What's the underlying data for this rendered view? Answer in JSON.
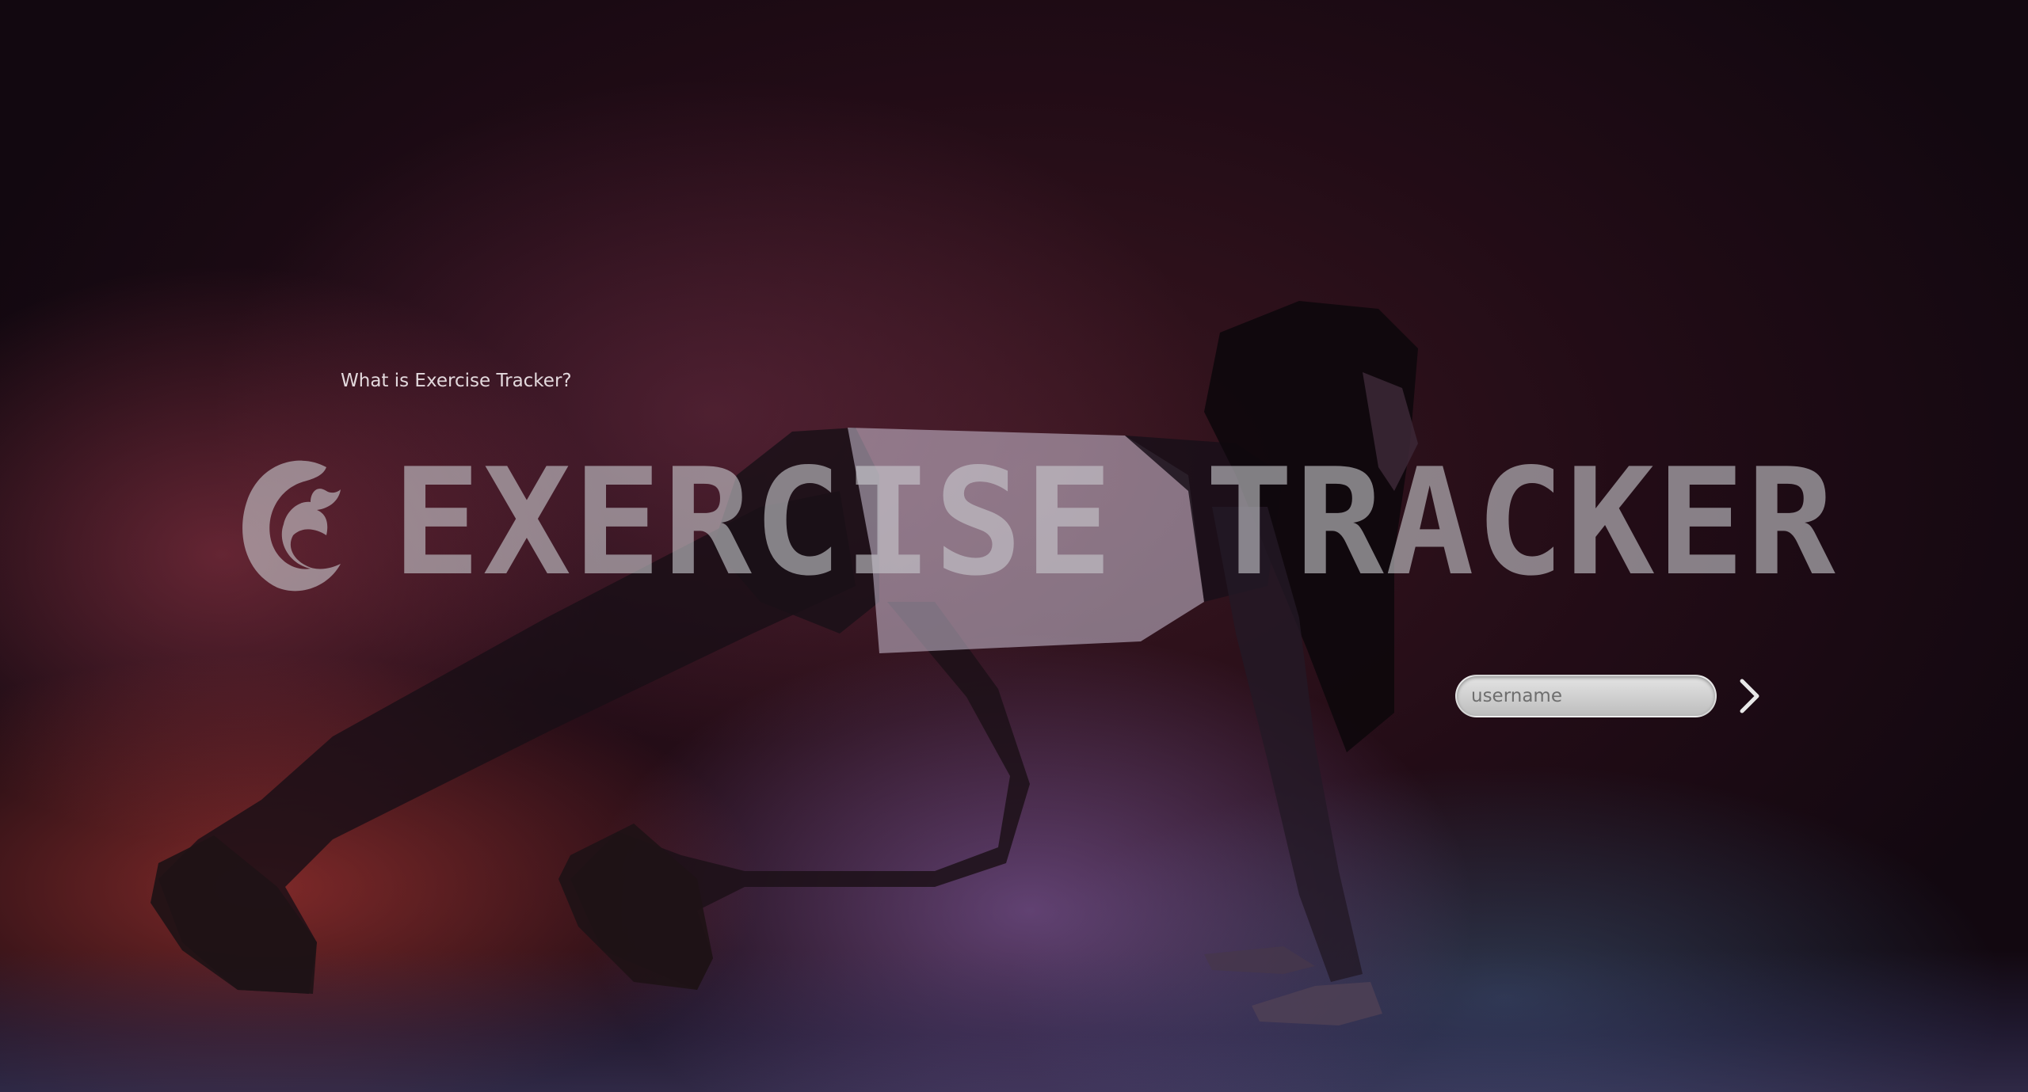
{
  "header": {
    "faq_link": "What is Exercise Tracker?"
  },
  "hero": {
    "title": "EXERCISE TRACKER"
  },
  "login": {
    "username_placeholder": "username",
    "submit_icon": "chevron-right-icon"
  },
  "colors": {
    "title": "#c8c8cd",
    "input_background": "#d4d4d4",
    "link": "#e3d9dd",
    "arrow": "#e8e8e8"
  }
}
